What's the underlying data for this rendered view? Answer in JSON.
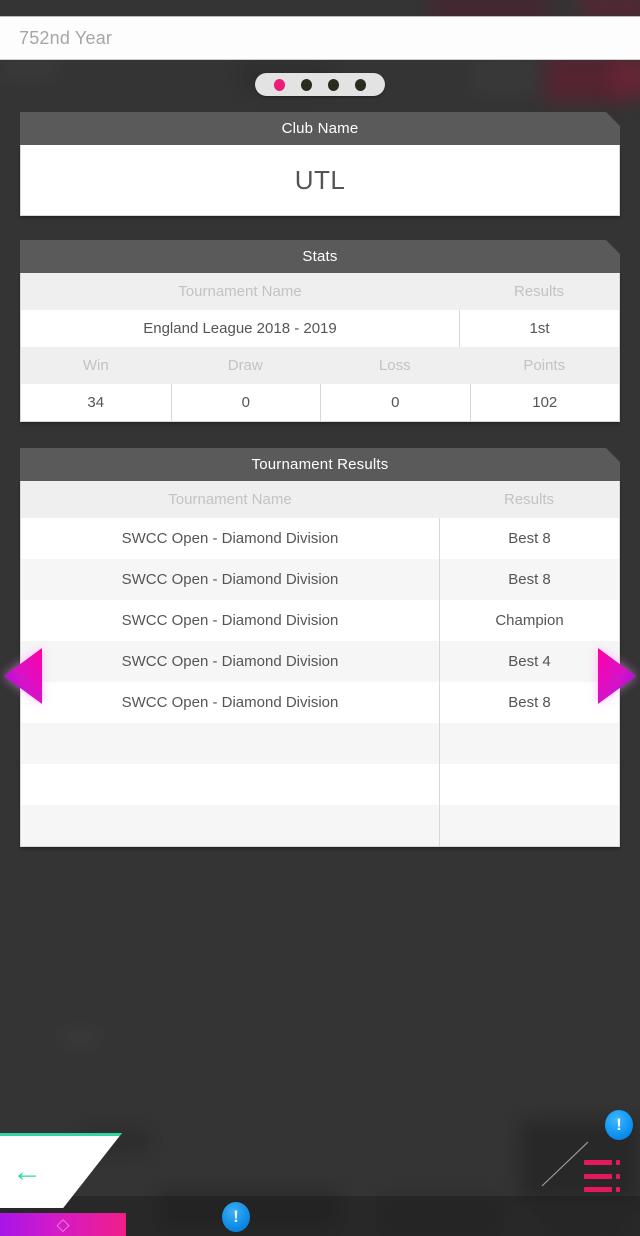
{
  "header": {
    "year_label": "752nd Year"
  },
  "pager": {
    "total": 4,
    "active_index": 0,
    "active_color": "#ec1d7a",
    "inactive_color": "#2b2b1e"
  },
  "club_panel": {
    "title": "Club Name",
    "value": "UTL"
  },
  "stats_panel": {
    "title": "Stats",
    "league_headers": [
      "Tournament Name",
      "Results"
    ],
    "league_row": {
      "tournament_name": "England League 2018 - 2019",
      "result": "1st"
    },
    "record_headers": [
      "Win",
      "Draw",
      "Loss",
      "Points"
    ],
    "record_values": [
      "34",
      "0",
      "0",
      "102"
    ]
  },
  "tournament_panel": {
    "title": "Tournament Results",
    "headers": [
      "Tournament Name",
      "Results"
    ],
    "rows": [
      {
        "name": "SWCC Open - Diamond Division",
        "result": "Best 8"
      },
      {
        "name": "SWCC Open - Diamond Division",
        "result": "Best 8"
      },
      {
        "name": "SWCC Open - Diamond Division",
        "result": "Champion"
      },
      {
        "name": "SWCC Open - Diamond Division",
        "result": "Best 4"
      },
      {
        "name": "SWCC Open - Diamond Division",
        "result": "Best 8"
      },
      {
        "name": "",
        "result": ""
      },
      {
        "name": "",
        "result": ""
      },
      {
        "name": "",
        "result": ""
      }
    ]
  },
  "nav": {
    "prev_icon": "triangle-left-icon",
    "next_icon": "triangle-right-icon",
    "arrow_color": "#d612c8"
  },
  "bottom_bar": {
    "back_icon": "arrow-left-icon",
    "back_glyph": "←",
    "back_accent": "#2fd6a3",
    "home_glyph": "◇",
    "alert_glyph": "!",
    "alert_color": "#0a8ef0",
    "list_icon": "list-menu-icon",
    "list_color": "#e5175f"
  },
  "colors": {
    "background": "#343434",
    "panel_header": "#5a5a5a",
    "panel_body": "#ffffff",
    "row_alt": "#f6f6f6",
    "table_header_bg": "#efefef",
    "table_header_text": "#c3c3c3",
    "value_text": "#555555"
  }
}
